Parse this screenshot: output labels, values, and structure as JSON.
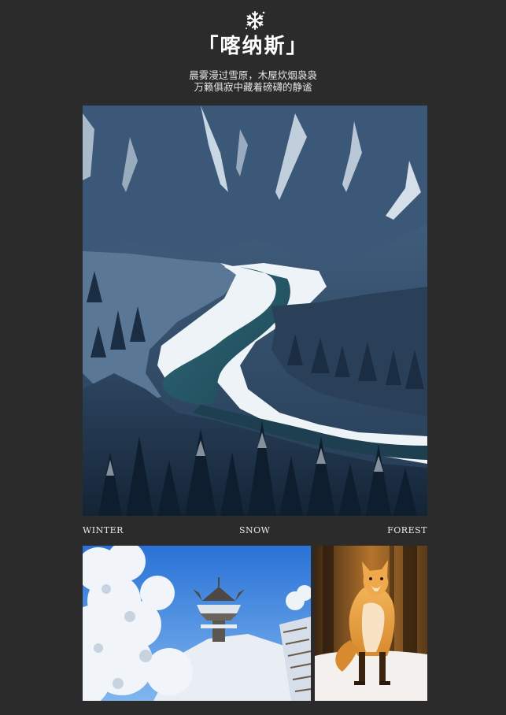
{
  "header": {
    "icon": "snowflake-icon",
    "title": "「喀纳斯」",
    "subtitle_lines": [
      "晨雾漫过雪原，木屋炊烟袅袅",
      "万籁俱寂中藏着磅礴的静谧"
    ]
  },
  "images": {
    "main": "snowy-valley-river-photo",
    "tower": "snow-tower-photo",
    "fox": "red-fox-in-snow-photo"
  },
  "labels": {
    "left": "WINTER",
    "center": "SNOW",
    "right": "FOREST"
  },
  "colors": {
    "background": "#2b2b2b",
    "text": "#ffffff"
  }
}
